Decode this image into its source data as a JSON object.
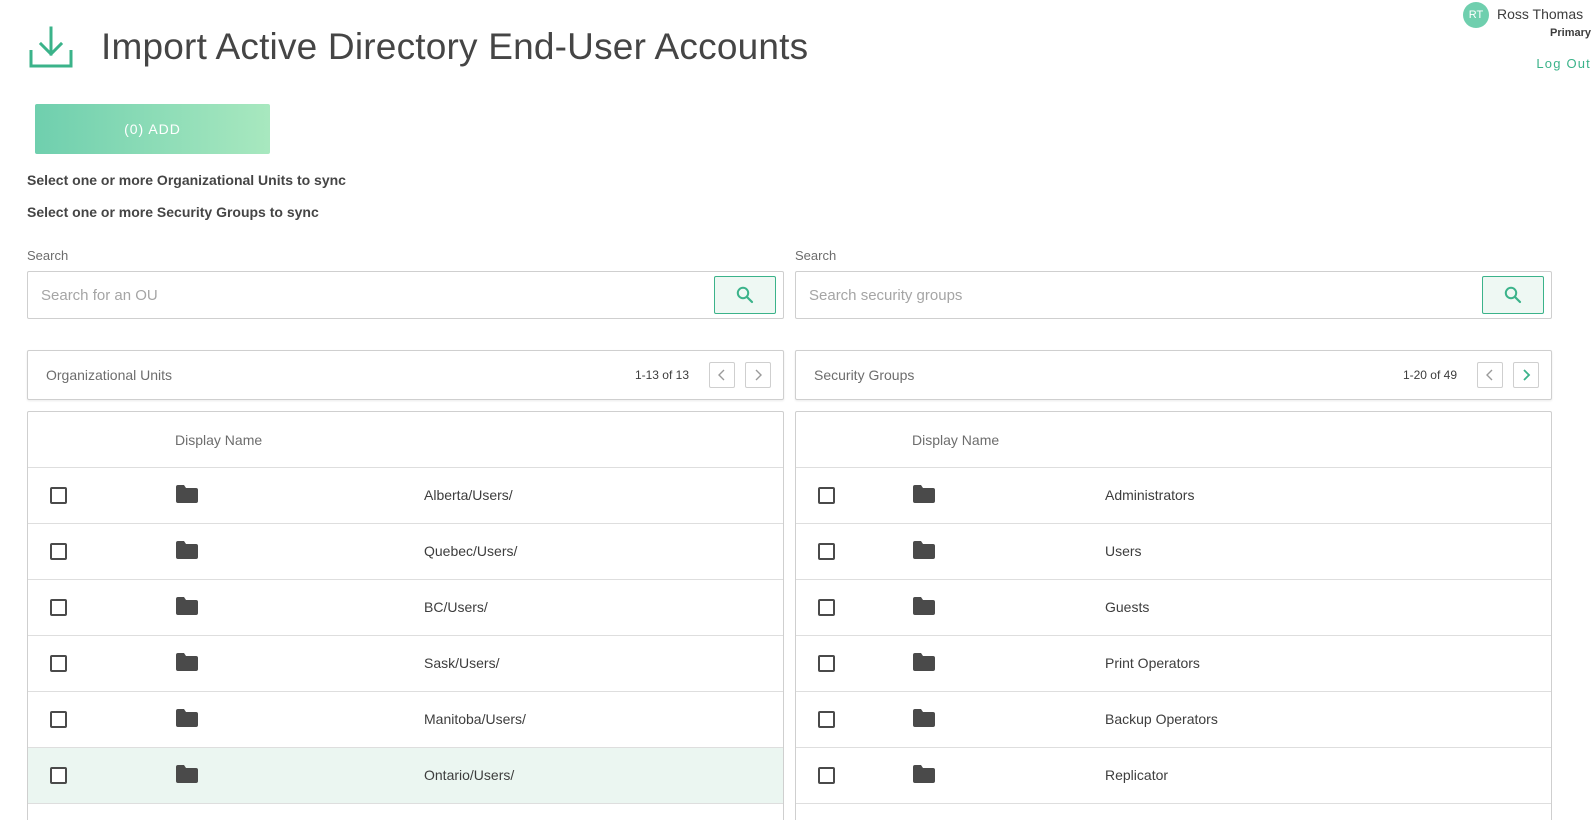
{
  "header": {
    "title": "Import Active Directory End-User Accounts",
    "icon": "download-icon",
    "accent_color": "#3bb38a"
  },
  "user": {
    "initials": "RT",
    "name": "Ross Thomas",
    "role": "Primary",
    "logout_label": "Log Out"
  },
  "toolbar": {
    "add_label": "(0) ADD"
  },
  "instructions": {
    "ou": "Select one or more Organizational Units to sync",
    "groups": "Select one or more Security Groups to sync"
  },
  "ou_panel": {
    "search_label": "Search",
    "search_placeholder": "Search for an OU",
    "title": "Organizational Units",
    "range": "1-13 of 13",
    "column_header": "Display Name",
    "rows": [
      {
        "label": "Alberta/Users/"
      },
      {
        "label": "Quebec/Users/"
      },
      {
        "label": "BC/Users/"
      },
      {
        "label": "Sask/Users/"
      },
      {
        "label": "Manitoba/Users/"
      },
      {
        "label": "Ontario/Users/"
      }
    ]
  },
  "group_panel": {
    "search_label": "Search",
    "search_placeholder": "Search security groups",
    "title": "Security Groups",
    "range": "1-20 of 49",
    "column_header": "Display Name",
    "rows": [
      {
        "label": "Administrators"
      },
      {
        "label": "Users"
      },
      {
        "label": "Guests"
      },
      {
        "label": "Print Operators"
      },
      {
        "label": "Backup Operators"
      },
      {
        "label": "Replicator"
      }
    ]
  }
}
